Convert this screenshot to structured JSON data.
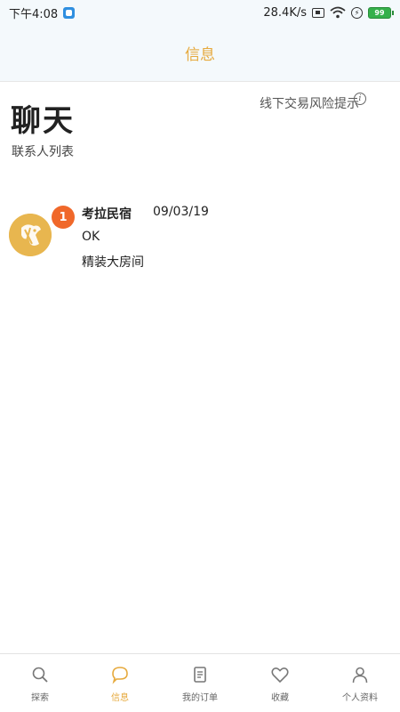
{
  "status_bar": {
    "time": "下午4:08",
    "network_speed": "28.4K/s",
    "battery": "99"
  },
  "header": {
    "title": "信息"
  },
  "page": {
    "title": "聊天",
    "subtitle": "联系人列表",
    "risk_link": "线下交易风险提示",
    "info_glyph": "i"
  },
  "chats": [
    {
      "unread": "1",
      "name": "考拉民宿",
      "date": "09/03/19",
      "message": "OK",
      "room": "精装大房间"
    }
  ],
  "tabs": [
    {
      "label": "探索",
      "icon": "search-icon",
      "active": false
    },
    {
      "label": "信息",
      "icon": "chat-bubble-icon",
      "active": true
    },
    {
      "label": "我的订单",
      "icon": "order-icon",
      "active": false
    },
    {
      "label": "收藏",
      "icon": "heart-icon",
      "active": false
    },
    {
      "label": "个人资料",
      "icon": "user-icon",
      "active": false
    }
  ],
  "colors": {
    "accent": "#e6a93c",
    "badge": "#f0682a",
    "header_bg": "#f4f9fc"
  }
}
